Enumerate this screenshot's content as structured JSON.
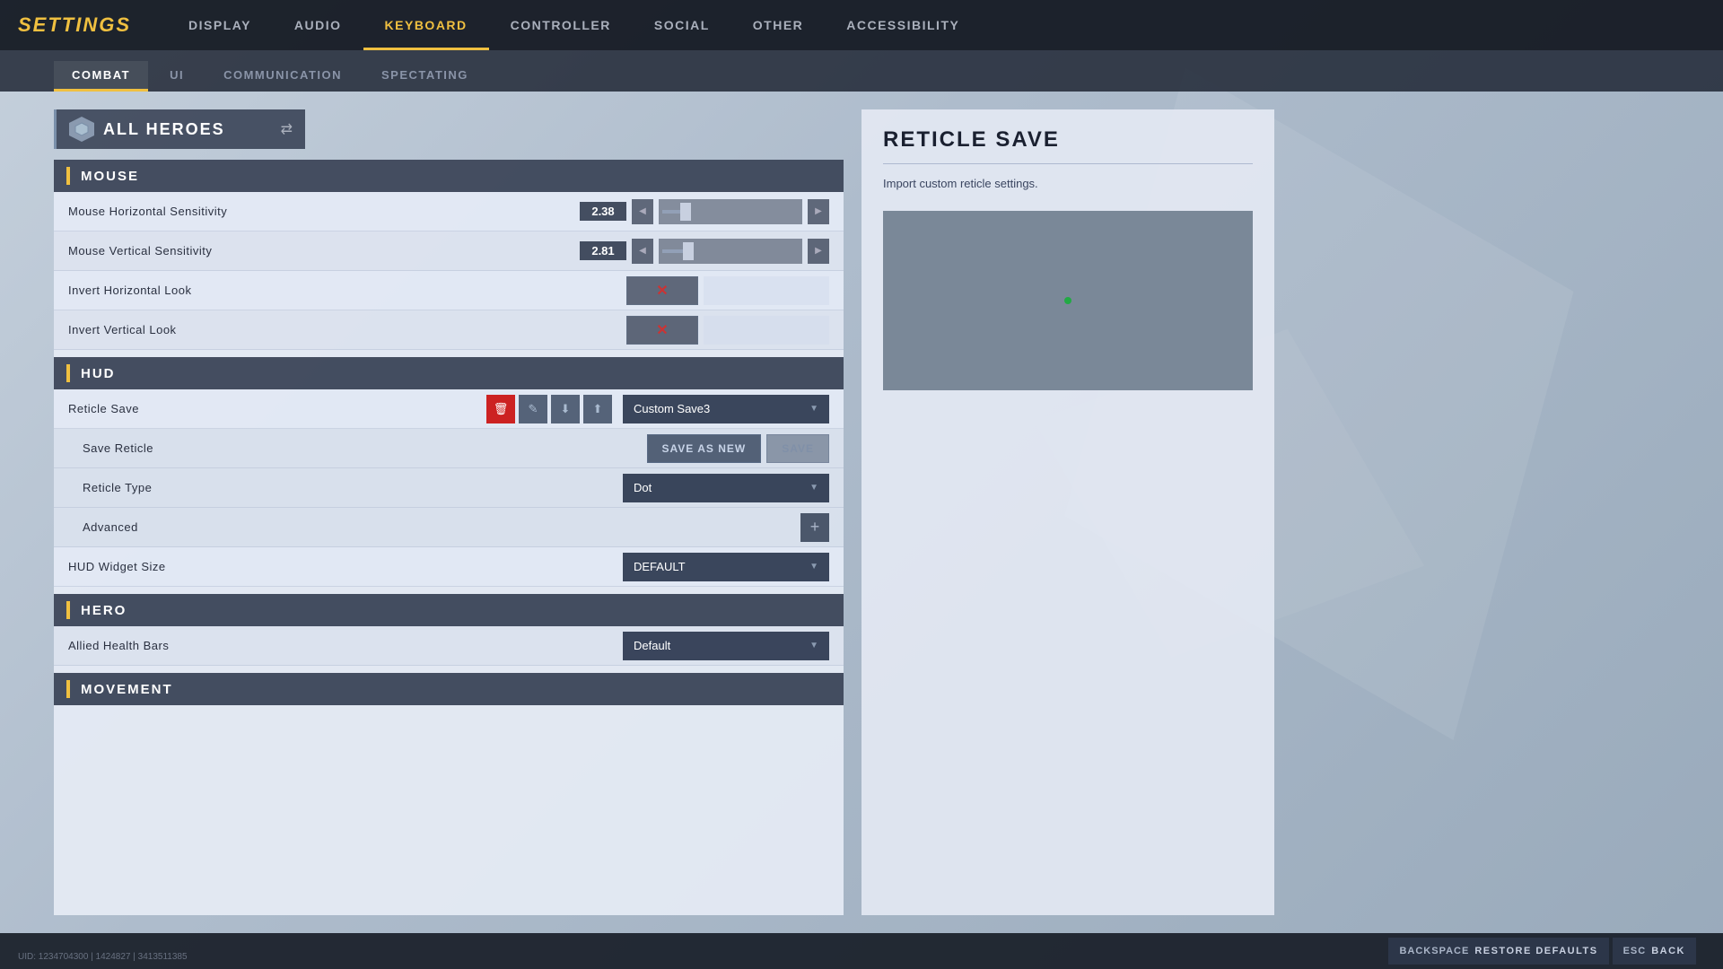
{
  "app": {
    "title": "SETTINGS"
  },
  "nav": {
    "items": [
      {
        "id": "display",
        "label": "DISPLAY",
        "active": false
      },
      {
        "id": "audio",
        "label": "AUDIO",
        "active": false
      },
      {
        "id": "keyboard",
        "label": "KEYBOARD",
        "active": true
      },
      {
        "id": "controller",
        "label": "CONTROLLER",
        "active": false
      },
      {
        "id": "social",
        "label": "SOCIAL",
        "active": false
      },
      {
        "id": "other",
        "label": "OTHER",
        "active": false
      },
      {
        "id": "accessibility",
        "label": "ACCESSIBILITY",
        "active": false
      }
    ]
  },
  "sub_tabs": {
    "items": [
      {
        "id": "combat",
        "label": "COMBAT",
        "active": true
      },
      {
        "id": "ui",
        "label": "UI",
        "active": false
      },
      {
        "id": "communication",
        "label": "COMMUNICATION",
        "active": false
      },
      {
        "id": "spectating",
        "label": "SPECTATING",
        "active": false
      }
    ]
  },
  "hero_selector": {
    "label": "ALL HEROES",
    "swap_label": "⇄"
  },
  "sections": {
    "mouse": {
      "title": "MOUSE",
      "rows": [
        {
          "label": "Mouse Horizontal Sensitivity",
          "type": "slider",
          "value": "2.38",
          "slider_pct": 15
        },
        {
          "label": "Mouse Vertical Sensitivity",
          "type": "slider",
          "value": "2.81",
          "slider_pct": 17
        },
        {
          "label": "Invert Horizontal Look",
          "type": "toggle",
          "value": false
        },
        {
          "label": "Invert Vertical Look",
          "type": "toggle",
          "value": false
        }
      ]
    },
    "hud": {
      "title": "HUD",
      "rows": [
        {
          "label": "Reticle Save",
          "type": "reticle_save",
          "dropdown_value": "Custom Save3"
        },
        {
          "label": "Save Reticle",
          "type": "save_reticle",
          "btn1": "SAVE AS NEW",
          "btn2": "SAVE"
        },
        {
          "label": "Reticle Type",
          "type": "dropdown",
          "value": "Dot"
        },
        {
          "label": "Advanced",
          "type": "expandable"
        },
        {
          "label": "HUD Widget Size",
          "type": "dropdown",
          "value": "DEFAULT"
        }
      ]
    },
    "hero": {
      "title": "HERO",
      "rows": [
        {
          "label": "Allied Health Bars",
          "type": "dropdown",
          "value": "Default"
        }
      ]
    },
    "movement": {
      "title": "MOVEMENT"
    }
  },
  "right_panel": {
    "title": "RETICLE SAVE",
    "description": "Import custom reticle settings."
  },
  "bottom_bar": {
    "restore_btn": {
      "key": "BACKSPACE",
      "label": "RESTORE DEFAULTS"
    },
    "back_btn": {
      "key": "ESC",
      "label": "BACK"
    },
    "version": "UID: 1234704300 | 1424827 | 3413511385"
  },
  "icons": {
    "chevron_right": "▶",
    "chevron_left": "◀",
    "chevron_down": "▼",
    "x_mark": "✕",
    "swap": "⇄",
    "trash": "🗑",
    "edit": "✎",
    "import": "↓",
    "export": "↑",
    "plus": "+"
  }
}
